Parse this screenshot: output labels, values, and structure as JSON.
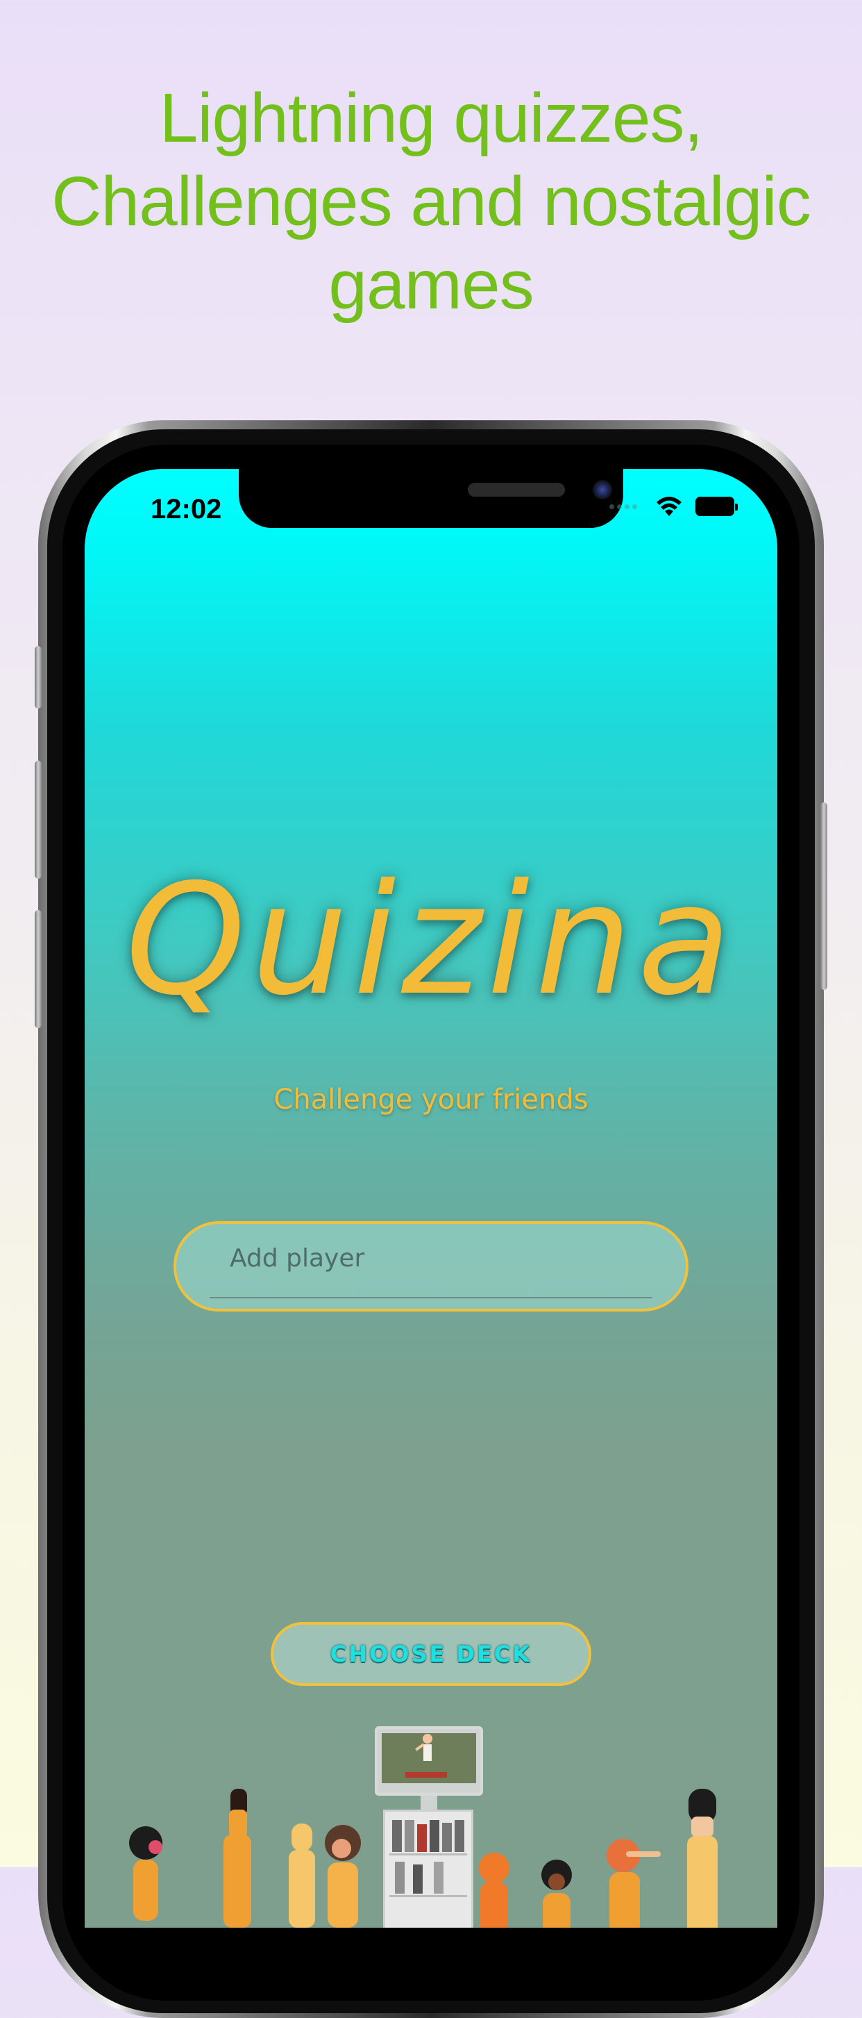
{
  "headline": {
    "lines": [
      "Lightning quizzes,",
      "Challenges and nostalgic",
      "games"
    ]
  },
  "status_bar": {
    "time": "12:02",
    "icons": [
      "signal-dots-icon",
      "wifi-icon",
      "battery-icon"
    ]
  },
  "app": {
    "logo": "Quizina",
    "tagline": "Challenge your friends",
    "player_input": {
      "placeholder": "Add player",
      "value": ""
    },
    "choose_deck_label": "CHOOSE DECK"
  },
  "colors": {
    "headline_green": "#73BF1C",
    "accent_yellow": "#F3BC38",
    "cyan": "#00FFFF",
    "button_text_cyan": "#1EE0E0"
  }
}
